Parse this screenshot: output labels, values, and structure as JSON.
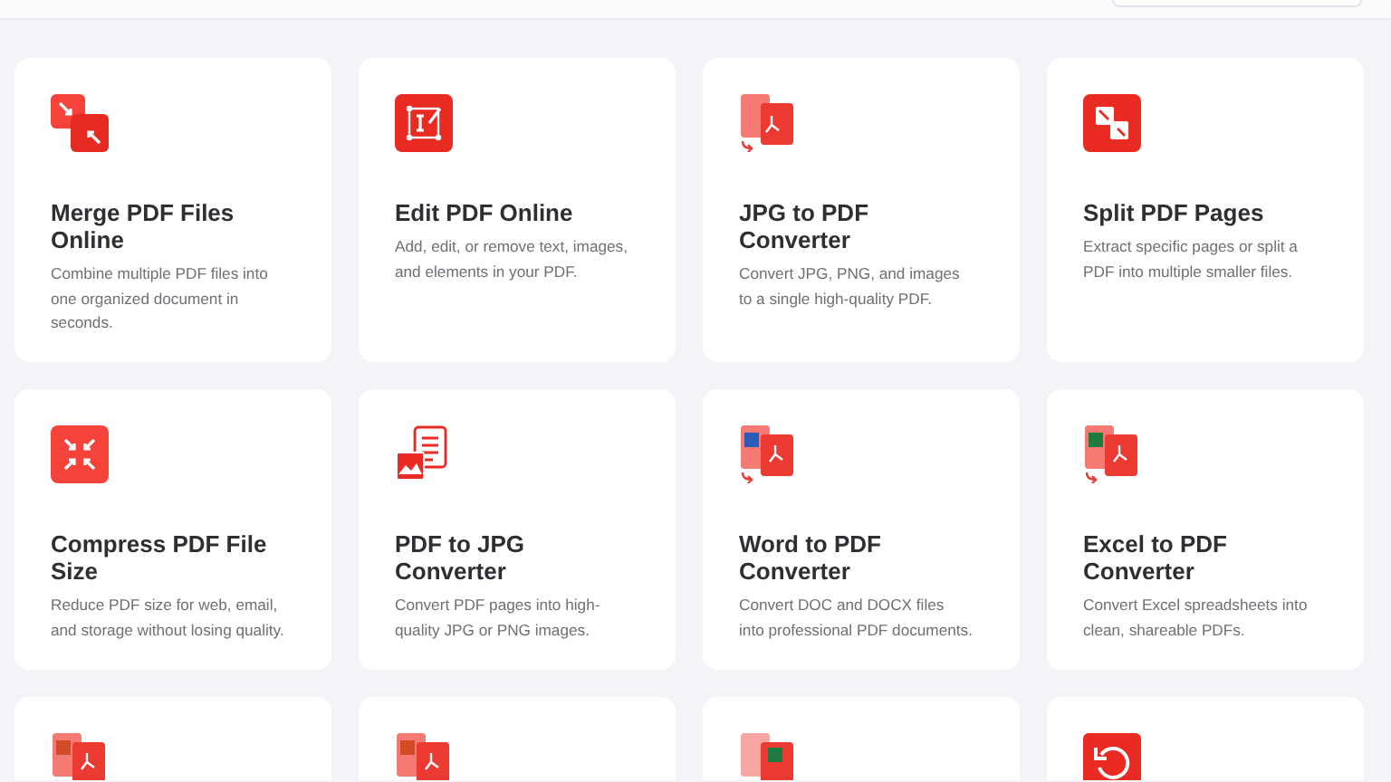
{
  "tools": [
    {
      "kind": "full",
      "title": "Merge PDF Files Online",
      "description": "Combine multiple PDF files into one organized document in seconds."
    },
    {
      "kind": "full",
      "title": "Edit PDF Online",
      "description": "Add, edit, or remove text, images, and elements in your PDF."
    },
    {
      "kind": "full",
      "title": "JPG to PDF Converter",
      "description": "Convert JPG, PNG, and images to a single high-quality PDF."
    },
    {
      "kind": "full",
      "title": "Split PDF Pages",
      "description": "Extract specific pages or split a PDF into multiple smaller files."
    },
    {
      "kind": "full",
      "title": "Compress PDF File Size",
      "description": "Reduce PDF size for web, email, and storage without losing quality."
    },
    {
      "kind": "full",
      "title": "PDF to JPG Converter",
      "description": "Convert PDF pages into high-quality JPG or PNG images."
    },
    {
      "kind": "full",
      "title": "Word to PDF Converter",
      "description": "Convert DOC and DOCX files into professional PDF documents."
    },
    {
      "kind": "full",
      "title": "Excel to PDF Converter",
      "description": "Convert Excel spreadsheets into clean, shareable PDFs."
    },
    {
      "kind": "icon-only"
    },
    {
      "kind": "icon-only"
    },
    {
      "kind": "icon-only"
    },
    {
      "kind": "icon-only"
    }
  ]
}
